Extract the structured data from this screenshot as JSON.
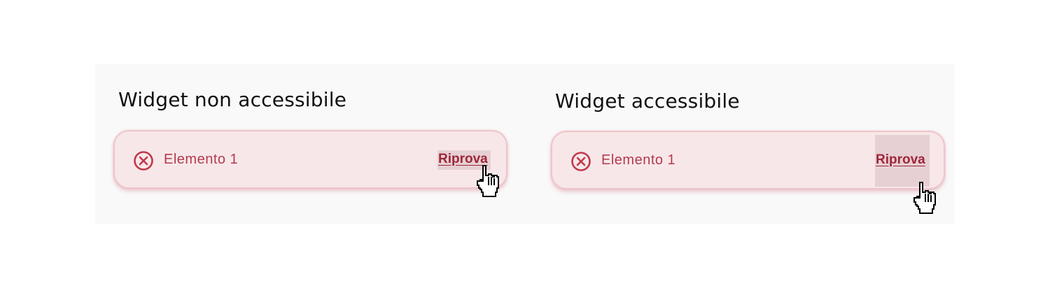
{
  "panels": {
    "non_accessible": {
      "heading": "Widget non accessibile",
      "item_label": "Elemento 1",
      "retry_label": "Riprova"
    },
    "accessible": {
      "heading": "Widget accessibile",
      "item_label": "Elemento 1",
      "retry_label": "Riprova"
    }
  },
  "icons": {
    "error": "error-circle-x-icon",
    "cursor": "hand-pointer-cursor-icon"
  },
  "colors": {
    "panel_background": "#f9f9f9",
    "widget_background": "#f7e7e9",
    "widget_border": "#efc4cb",
    "error_red": "#c0394b",
    "label_red": "#b43a4c",
    "link_red": "#a02639",
    "touch_target_highlight": "#e6d0d4"
  }
}
